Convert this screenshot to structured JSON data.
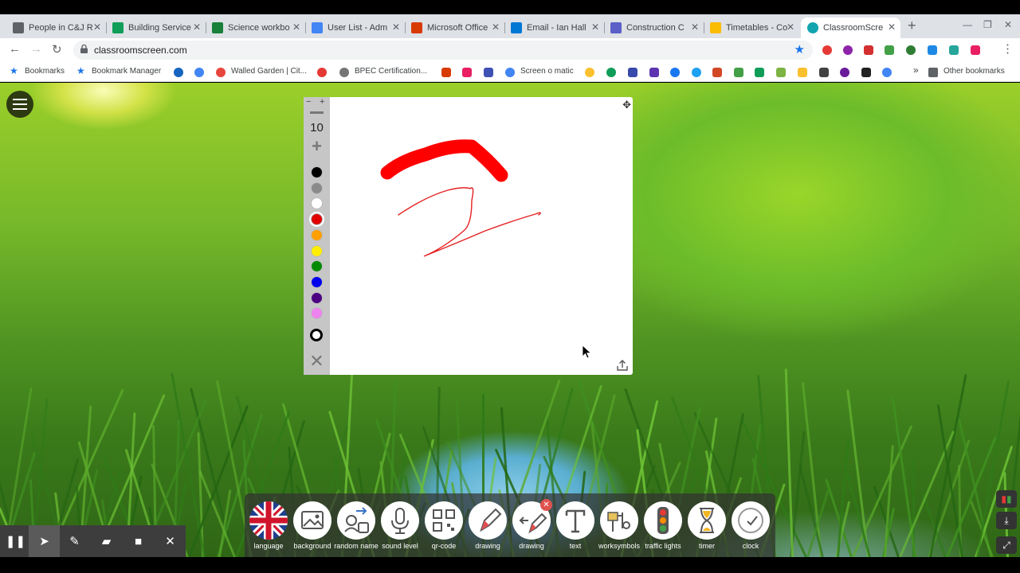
{
  "browser": {
    "tabs": [
      {
        "title": "People in C&J R",
        "color": "#5f6368"
      },
      {
        "title": "Building Service",
        "color": "#0f9d58"
      },
      {
        "title": "Science workbo",
        "color": "#188038"
      },
      {
        "title": "User List - Adm",
        "color": "#4285f4"
      },
      {
        "title": "Microsoft Office",
        "color": "#d83b01"
      },
      {
        "title": "Email - Ian Hall",
        "color": "#0078d4"
      },
      {
        "title": "Construction C",
        "color": "#5b5fc7"
      },
      {
        "title": "Timetables - Co",
        "color": "#fbbc04"
      },
      {
        "title": "ClassroomScre",
        "color": "#12a4af"
      }
    ],
    "url": "classroomscreen.com",
    "bookmarks": [
      {
        "label": "Bookmarks",
        "color": "#1a73e8"
      },
      {
        "label": "Bookmark Manager",
        "color": "#1a73e8"
      },
      {
        "label": "Walled Garden | Cit...",
        "color": "#e8453c"
      },
      {
        "label": "BPEC Certification...",
        "color": "#9e9e9e"
      },
      {
        "label": "Screen o matic",
        "color": "#4285f4"
      }
    ],
    "other_bookmarks": "Other bookmarks"
  },
  "drawing": {
    "brush_size": "10",
    "colors": [
      "#000000",
      "#8a8a8a",
      "#ffffff",
      "#e00000",
      "#ff9f00",
      "#ffee00",
      "#008a00",
      "#0000ee",
      "#4b0082",
      "#ee82ee"
    ],
    "selected_color": "#e00000"
  },
  "dock": {
    "items": [
      "language",
      "background",
      "random name",
      "sound level",
      "qr-code",
      "drawing",
      "drawing",
      "text",
      "worksymbols",
      "traffic lights",
      "timer",
      "clock"
    ]
  },
  "colors": {
    "accent": "#ff0000"
  }
}
